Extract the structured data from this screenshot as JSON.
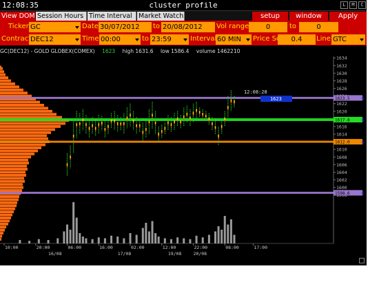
{
  "window": {
    "clock": "12:08:35",
    "title": "cluster profile",
    "buttons": [
      "L",
      "M",
      "C"
    ]
  },
  "menu": {
    "tabs": [
      "View DOM",
      "Session Hours",
      "Time Interval",
      "Market Watch"
    ],
    "actions": [
      "setup",
      "window",
      "Apply"
    ]
  },
  "controls": {
    "ticker_label": "Ticker",
    "ticker": "GC",
    "date_label": "Date",
    "date_from": "30/07/2012",
    "to_label": "to",
    "date_to": "20/08/2012",
    "vol_range_label": "Vol range",
    "vol_from": "0",
    "vol_to_label": "to",
    "vol_to": "0",
    "contract_label": "Contract",
    "contract": "DEC12",
    "time_label": "Time",
    "time_from": "00:00",
    "time_to_label": "to",
    "time_to": "23:59",
    "interval_label": "Interval",
    "interval": "60 MIN",
    "price_scale_label": "Price Scale",
    "price_scale": "0.4",
    "line_label": "Line",
    "line": "GTC"
  },
  "info": {
    "symbol": "GC(DEC12) - GOLD GLOBEX(COMEX)",
    "last": "1623",
    "high": "high 1631.6",
    "low": "low 1586.4",
    "volume": "volume 1462210"
  },
  "colors": {
    "profile": "#ff6a10",
    "green_line": "#22dd22",
    "orange_line": "#ee8800",
    "purple_line": "#9977cc",
    "label_blue": "#1133cc"
  },
  "chart_data": {
    "type": "line",
    "ylim": [
      1586.4,
      1634.4
    ],
    "yticks": [
      "1634",
      "1632",
      "1630",
      "1628",
      "1626",
      "1624",
      "1622",
      "1620",
      "1618",
      "1616",
      "1614",
      "1612",
      "1610",
      "1608",
      "1606",
      "1604",
      "1602",
      "1600",
      "1598"
    ],
    "xticks": [
      {
        "label": "10:00",
        "x": 0
      },
      {
        "label": "20:00",
        "x": 10
      },
      {
        "label": "06:00",
        "x": 20
      },
      {
        "label": "16:00",
        "x": 30
      },
      {
        "label": "02:00",
        "x": 40
      },
      {
        "label": "12:00",
        "x": 50
      },
      {
        "label": "22:00",
        "x": 60
      },
      {
        "label": "08:00",
        "x": 70
      },
      {
        "label": "17:00",
        "x": 79
      }
    ],
    "date_labels": [
      {
        "label": "16/08",
        "x": 14
      },
      {
        "label": "17/08",
        "x": 36
      },
      {
        "label": "19/08",
        "x": 52
      },
      {
        "label": "20/08",
        "x": 60
      }
    ],
    "levels": [
      {
        "name": "poc",
        "price": 1617.8,
        "label": "1617.8",
        "color": "#22dd22"
      },
      {
        "name": "gtc-top",
        "price": 1623.5,
        "label": "1623.5",
        "color": "#9977cc"
      },
      {
        "name": "gtc-mid",
        "price": 1612.0,
        "label": "1612.0",
        "color": "#ee8800"
      },
      {
        "name": "gtc-low",
        "price": 1598.6,
        "label": "1598.6",
        "color": "#9977cc"
      }
    ],
    "last_time": "12:08:28",
    "last_price": "1623",
    "profile": {
      "prices": [
        1586.4,
        1587.2,
        1588.0,
        1588.8,
        1589.6,
        1590.4,
        1591.2,
        1592.0,
        1592.8,
        1593.6,
        1594.4,
        1595.2,
        1596.0,
        1596.8,
        1597.6,
        1598.4,
        1599.2,
        1600.0,
        1600.8,
        1601.6,
        1602.4,
        1603.2,
        1604.0,
        1604.8,
        1605.6,
        1606.4,
        1607.2,
        1608.0,
        1608.8,
        1609.6,
        1610.4,
        1611.2,
        1612.0,
        1612.8,
        1613.6,
        1614.4,
        1615.2,
        1616.0,
        1616.8,
        1617.6,
        1618.4,
        1619.2,
        1620.0,
        1620.8,
        1621.6,
        1622.4,
        1623.2,
        1624.0,
        1624.8,
        1625.6,
        1626.4,
        1627.2,
        1628.0,
        1628.8,
        1629.6,
        1630.4,
        1631.2,
        1631.6
      ],
      "volumes": [
        2,
        3,
        5,
        7,
        9,
        12,
        14,
        16,
        18,
        20,
        22,
        24,
        25,
        27,
        28,
        30,
        32,
        34,
        33,
        36,
        35,
        38,
        37,
        40,
        39,
        42,
        41,
        45,
        50,
        55,
        60,
        66,
        72,
        70,
        68,
        74,
        80,
        88,
        95,
        100,
        90,
        82,
        76,
        70,
        64,
        58,
        52,
        46,
        40,
        34,
        28,
        22,
        16,
        12,
        8,
        6,
        4,
        2
      ]
    },
    "bars": [
      {
        "x": 20,
        "lo": 1603.0,
        "hi": 1609.0
      },
      {
        "x": 21,
        "lo": 1605.0,
        "hi": 1611.0
      },
      {
        "x": 22,
        "lo": 1609.0,
        "hi": 1618.0
      },
      {
        "x": 23,
        "lo": 1613.0,
        "hi": 1620.0
      },
      {
        "x": 24,
        "lo": 1614.0,
        "hi": 1619.5
      },
      {
        "x": 25,
        "lo": 1615.0,
        "hi": 1620.5
      },
      {
        "x": 26,
        "lo": 1614.0,
        "hi": 1619.0
      },
      {
        "x": 27,
        "lo": 1613.0,
        "hi": 1618.0
      },
      {
        "x": 28,
        "lo": 1614.0,
        "hi": 1618.5
      },
      {
        "x": 29,
        "lo": 1613.5,
        "hi": 1617.5
      },
      {
        "x": 30,
        "lo": 1614.0,
        "hi": 1619.0
      },
      {
        "x": 31,
        "lo": 1615.0,
        "hi": 1618.8
      },
      {
        "x": 32,
        "lo": 1613.0,
        "hi": 1617.5
      },
      {
        "x": 33,
        "lo": 1614.0,
        "hi": 1618.0
      },
      {
        "x": 34,
        "lo": 1615.5,
        "hi": 1619.5
      },
      {
        "x": 35,
        "lo": 1615.0,
        "hi": 1620.0
      },
      {
        "x": 36,
        "lo": 1614.5,
        "hi": 1619.0
      },
      {
        "x": 37,
        "lo": 1615.0,
        "hi": 1618.5
      },
      {
        "x": 38,
        "lo": 1614.0,
        "hi": 1619.5
      },
      {
        "x": 39,
        "lo": 1615.5,
        "hi": 1621.0
      },
      {
        "x": 40,
        "lo": 1616.0,
        "hi": 1622.0
      },
      {
        "x": 41,
        "lo": 1615.0,
        "hi": 1620.0
      },
      {
        "x": 42,
        "lo": 1614.0,
        "hi": 1618.5
      },
      {
        "x": 43,
        "lo": 1614.5,
        "hi": 1618.0
      },
      {
        "x": 44,
        "lo": 1612.0,
        "hi": 1617.0
      },
      {
        "x": 45,
        "lo": 1613.0,
        "hi": 1617.5
      },
      {
        "x": 46,
        "lo": 1614.0,
        "hi": 1620.5
      },
      {
        "x": 47,
        "lo": 1615.5,
        "hi": 1622.5
      },
      {
        "x": 48,
        "lo": 1614.0,
        "hi": 1620.0
      },
      {
        "x": 49,
        "lo": 1612.0,
        "hi": 1616.0
      },
      {
        "x": 50,
        "lo": 1613.0,
        "hi": 1616.5
      },
      {
        "x": 51,
        "lo": 1614.0,
        "hi": 1617.0
      },
      {
        "x": 52,
        "lo": 1615.0,
        "hi": 1619.0
      },
      {
        "x": 53,
        "lo": 1614.5,
        "hi": 1618.5
      },
      {
        "x": 54,
        "lo": 1615.0,
        "hi": 1619.5
      },
      {
        "x": 55,
        "lo": 1616.0,
        "hi": 1620.0
      },
      {
        "x": 56,
        "lo": 1615.5,
        "hi": 1619.0
      },
      {
        "x": 57,
        "lo": 1616.0,
        "hi": 1621.0
      },
      {
        "x": 58,
        "lo": 1617.0,
        "hi": 1621.5
      },
      {
        "x": 59,
        "lo": 1616.0,
        "hi": 1620.5
      },
      {
        "x": 60,
        "lo": 1617.0,
        "hi": 1622.0
      },
      {
        "x": 61,
        "lo": 1618.0,
        "hi": 1622.5
      },
      {
        "x": 62,
        "lo": 1618.5,
        "hi": 1621.0
      },
      {
        "x": 63,
        "lo": 1618.0,
        "hi": 1620.5
      },
      {
        "x": 64,
        "lo": 1617.5,
        "hi": 1620.0
      },
      {
        "x": 65,
        "lo": 1616.5,
        "hi": 1619.5
      },
      {
        "x": 66,
        "lo": 1615.0,
        "hi": 1618.5
      },
      {
        "x": 67,
        "lo": 1614.0,
        "hi": 1617.5
      },
      {
        "x": 68,
        "lo": 1611.0,
        "hi": 1616.0
      },
      {
        "x": 69,
        "lo": 1614.0,
        "hi": 1618.0
      },
      {
        "x": 70,
        "lo": 1616.0,
        "hi": 1620.0
      },
      {
        "x": 71,
        "lo": 1618.0,
        "hi": 1624.0
      },
      {
        "x": 72,
        "lo": 1620.0,
        "hi": 1625.5
      },
      {
        "x": 73,
        "lo": 1621.0,
        "hi": 1624.0
      }
    ],
    "volume_bars": [
      {
        "x": 5,
        "v": 4
      },
      {
        "x": 8,
        "v": 3
      },
      {
        "x": 11,
        "v": 5
      },
      {
        "x": 14,
        "v": 4
      },
      {
        "x": 17,
        "v": 6
      },
      {
        "x": 19,
        "v": 14
      },
      {
        "x": 20,
        "v": 22
      },
      {
        "x": 21,
        "v": 16
      },
      {
        "x": 22,
        "v": 48
      },
      {
        "x": 23,
        "v": 30
      },
      {
        "x": 24,
        "v": 12
      },
      {
        "x": 25,
        "v": 8
      },
      {
        "x": 26,
        "v": 6
      },
      {
        "x": 28,
        "v": 5
      },
      {
        "x": 30,
        "v": 7
      },
      {
        "x": 32,
        "v": 6
      },
      {
        "x": 34,
        "v": 9
      },
      {
        "x": 36,
        "v": 8
      },
      {
        "x": 38,
        "v": 6
      },
      {
        "x": 40,
        "v": 12
      },
      {
        "x": 42,
        "v": 10
      },
      {
        "x": 44,
        "v": 18
      },
      {
        "x": 45,
        "v": 24
      },
      {
        "x": 46,
        "v": 14
      },
      {
        "x": 47,
        "v": 26
      },
      {
        "x": 48,
        "v": 12
      },
      {
        "x": 49,
        "v": 8
      },
      {
        "x": 51,
        "v": 6
      },
      {
        "x": 53,
        "v": 5
      },
      {
        "x": 55,
        "v": 7
      },
      {
        "x": 57,
        "v": 6
      },
      {
        "x": 59,
        "v": 5
      },
      {
        "x": 61,
        "v": 9
      },
      {
        "x": 63,
        "v": 7
      },
      {
        "x": 65,
        "v": 10
      },
      {
        "x": 67,
        "v": 14
      },
      {
        "x": 68,
        "v": 20
      },
      {
        "x": 69,
        "v": 16
      },
      {
        "x": 70,
        "v": 32
      },
      {
        "x": 71,
        "v": 22
      },
      {
        "x": 72,
        "v": 28
      },
      {
        "x": 73,
        "v": 10
      }
    ]
  }
}
